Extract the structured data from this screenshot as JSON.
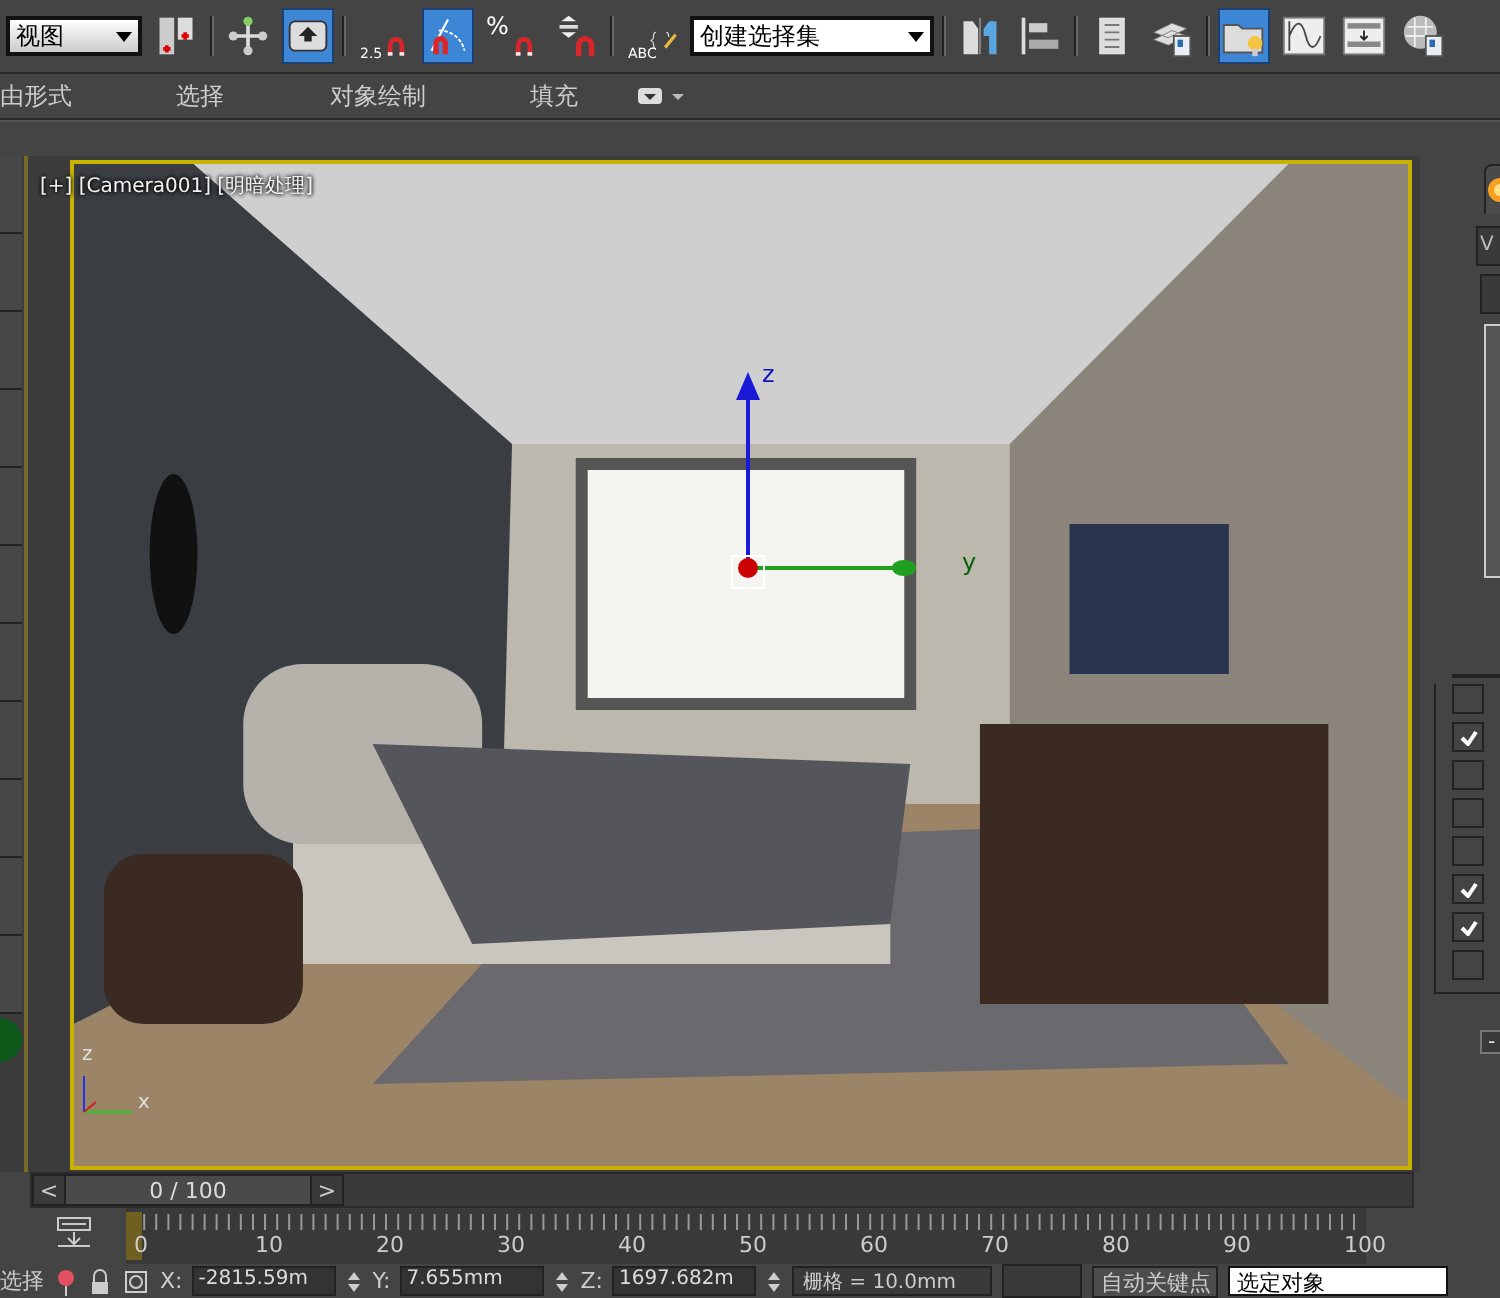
{
  "toolbar": {
    "items": [
      {
        "kind": "dropdown",
        "value": "视图"
      },
      {
        "kind": "button",
        "selected": false
      },
      {
        "kind": "button",
        "selected": false
      },
      {
        "kind": "button",
        "selected": true
      },
      {
        "kind": "button",
        "label": "2.5",
        "selected": false
      },
      {
        "kind": "button",
        "selected": true
      },
      {
        "kind": "button",
        "label": "%",
        "selected": false
      },
      {
        "kind": "button",
        "selected": false
      },
      {
        "kind": "button",
        "label": "ABC",
        "selected": false
      },
      {
        "kind": "dropdown",
        "value": "创建选择集"
      },
      {
        "kind": "button",
        "selected": false
      },
      {
        "kind": "button",
        "selected": false
      },
      {
        "kind": "button",
        "selected": false
      },
      {
        "kind": "button",
        "selected": false
      },
      {
        "kind": "button",
        "selected": true
      },
      {
        "kind": "button",
        "selected": false
      },
      {
        "kind": "button",
        "selected": false
      },
      {
        "kind": "button",
        "selected": false
      }
    ]
  },
  "ribbon": {
    "tabs": [
      "由形式",
      "选择",
      "对象绘制",
      "填充"
    ]
  },
  "viewport": {
    "label": "[+] [Camera001] [明暗处理]",
    "gizmo_axes": [
      "z",
      "y"
    ],
    "tripod_axes": [
      "z",
      "x"
    ]
  },
  "side_panel": {
    "fields": [
      "V"
    ],
    "checkboxes": [
      {
        "checked": false
      },
      {
        "checked": true
      },
      {
        "checked": false
      },
      {
        "checked": false
      },
      {
        "checked": false
      },
      {
        "checked": true
      },
      {
        "checked": true
      },
      {
        "checked": false
      }
    ],
    "collapse": "-"
  },
  "time_slider": {
    "prev": "<",
    "position": "0 / 100",
    "next": ">",
    "level": 0
  },
  "track_bar": {
    "ticks": [
      "0",
      "10",
      "20",
      "30",
      "40",
      "50",
      "60",
      "70",
      "80",
      "90",
      "100"
    ]
  },
  "status_bar": {
    "prompt": "选择",
    "coords": [
      {
        "label": "X:",
        "value": "-2815.59m"
      },
      {
        "label": "Y:",
        "value": "7.655mm"
      },
      {
        "label": "Z:",
        "value": "1697.682m"
      }
    ],
    "grid": "栅格 = 10.0mm",
    "auto_key": "自动关键点",
    "key_filter": "选定对象"
  }
}
